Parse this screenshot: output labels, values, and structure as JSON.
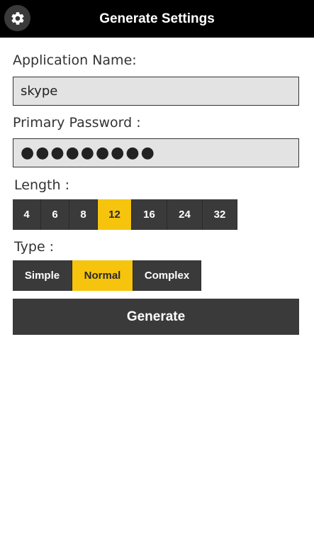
{
  "header": {
    "title": "Generate Settings",
    "settings_icon": "gear-icon"
  },
  "form": {
    "app_name_label": "Application Name:",
    "app_name_value": "skype",
    "primary_password_label": "Primary Password :",
    "primary_password_value": "●●●●●●●●●",
    "length_label": "Length :",
    "length_options": [
      "4",
      "6",
      "8",
      "12",
      "16",
      "24",
      "32"
    ],
    "length_selected": "12",
    "type_label": "Type :",
    "type_options": [
      "Simple",
      "Normal",
      "Complex"
    ],
    "type_selected": "Normal",
    "generate_label": "Generate"
  },
  "colors": {
    "header_bg": "#000000",
    "button_bg": "#3a3a3a",
    "accent": "#f6c40d",
    "field_bg": "#e3e3e3"
  }
}
